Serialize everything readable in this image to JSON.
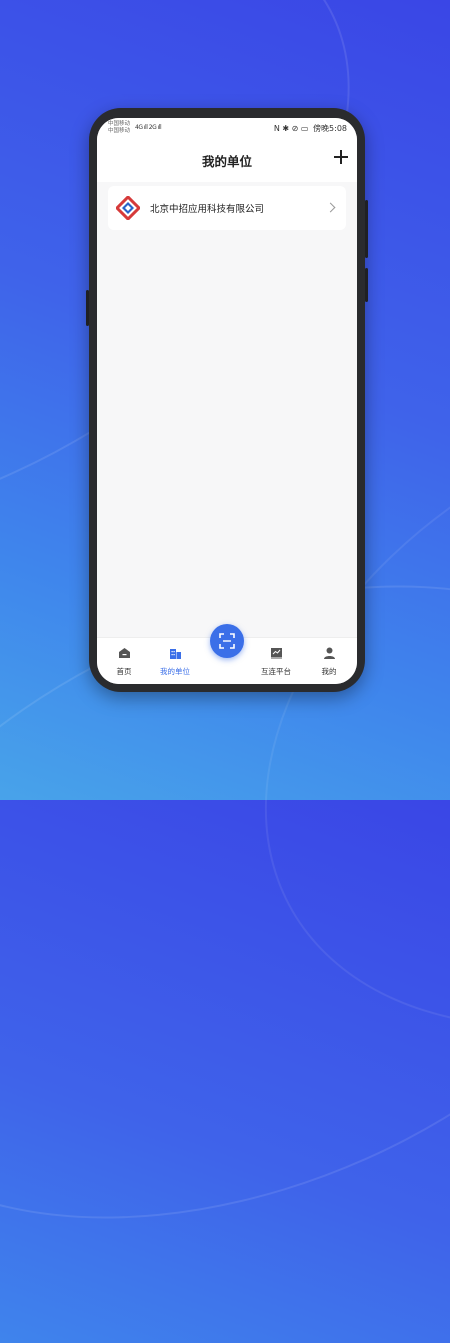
{
  "statusbar": {
    "carrier1": "中国移动",
    "carrier2": "中国移动",
    "signal": "4G ıll 2G ıll",
    "icons": "N ✱ ⊘ ▭",
    "time": "傍晚5:08"
  },
  "header": {
    "title": "我的单位"
  },
  "company": {
    "name": "北京中招应用科技有限公司"
  },
  "tabbar": {
    "tabs": [
      {
        "label": "首页"
      },
      {
        "label": "我的单位"
      },
      {
        "label": "互连平台"
      },
      {
        "label": "我的"
      }
    ]
  },
  "colors": {
    "accent": "#3b6fe8",
    "logo_red": "#d63a3a",
    "logo_blue": "#2a63c9"
  }
}
